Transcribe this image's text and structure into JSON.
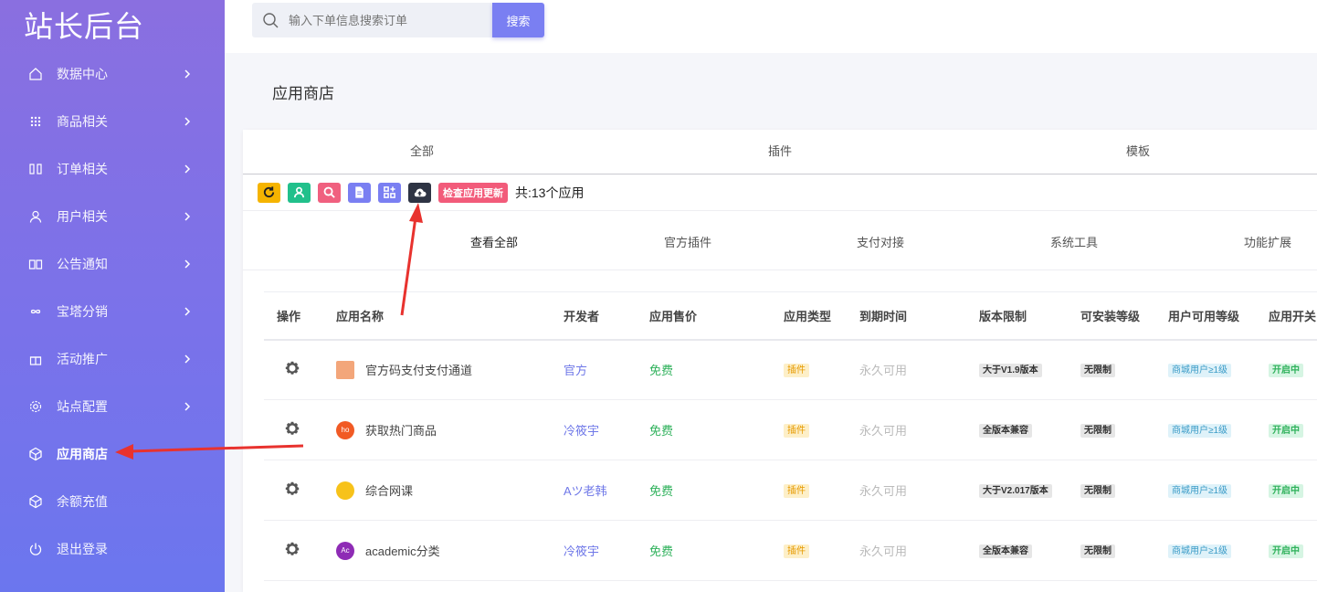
{
  "brand": "站长后台",
  "sidebar": {
    "items": [
      {
        "label": "数据中心",
        "icon": "home-icon",
        "chevron": true
      },
      {
        "label": "商品相关",
        "icon": "grid-dots-icon",
        "chevron": true
      },
      {
        "label": "订单相关",
        "icon": "columns-icon",
        "chevron": true
      },
      {
        "label": "用户相关",
        "icon": "user-icon",
        "chevron": true
      },
      {
        "label": "公告通知",
        "icon": "book-icon",
        "chevron": true
      },
      {
        "label": "宝塔分销",
        "icon": "infinity-icon",
        "chevron": true
      },
      {
        "label": "活动推广",
        "icon": "gift-icon",
        "chevron": true
      },
      {
        "label": "站点配置",
        "icon": "gear-icon",
        "chevron": true
      },
      {
        "label": "应用商店",
        "icon": "cube-icon",
        "chevron": false,
        "active": true
      },
      {
        "label": "余额充值",
        "icon": "cube-icon",
        "chevron": false
      },
      {
        "label": "退出登录",
        "icon": "power-icon",
        "chevron": false
      }
    ]
  },
  "search": {
    "placeholder": "输入下单信息搜索订单",
    "button": "搜索"
  },
  "page_title": "应用商店",
  "tabs": [
    "全部",
    "插件",
    "模板"
  ],
  "toolbar": {
    "icons": [
      {
        "name": "refresh-icon",
        "color": "#f5b400"
      },
      {
        "name": "user-icon",
        "color": "#21c08b"
      },
      {
        "name": "search-icon",
        "color": "#f0607f"
      },
      {
        "name": "document-icon",
        "color": "#7a7ff2"
      },
      {
        "name": "apps-add-icon",
        "color": "#7a7ff2"
      },
      {
        "name": "cloud-upload-icon",
        "color": "#2e3444"
      }
    ],
    "update_label": "检查应用更新",
    "count_label": "共:13个应用"
  },
  "categories": [
    "查看全部",
    "官方插件",
    "支付对接",
    "系统工具",
    "功能扩展"
  ],
  "table": {
    "headers": [
      "操作",
      "应用名称",
      "开发者",
      "应用售价",
      "应用类型",
      "到期时间",
      "版本限制",
      "可安装等级",
      "用户可用等级",
      "应用开关"
    ],
    "rows": [
      {
        "name": "官方码支付支付通道",
        "icon_color": "#f3a67a",
        "icon_text": "",
        "dev": "官方",
        "price": "免费",
        "type": "插件",
        "expire": "永久可用",
        "version": "大于V1.9版本",
        "level": "无限制",
        "user_level": "商城用户≥1级",
        "switch": "开启中"
      },
      {
        "name": "获取热门商品",
        "icon_color": "#f15a24",
        "icon_text": "ho",
        "dev": "冷筱宇",
        "price": "免费",
        "type": "插件",
        "expire": "永久可用",
        "version": "全版本兼容",
        "level": "无限制",
        "user_level": "商城用户≥1级",
        "switch": "开启中"
      },
      {
        "name": "综合网课",
        "icon_color": "#f7c21a",
        "icon_text": "",
        "dev": "Aツ老韩",
        "price": "免费",
        "type": "插件",
        "expire": "永久可用",
        "version": "大于V2.017版本",
        "level": "无限制",
        "user_level": "商城用户≥1级",
        "switch": "开启中"
      },
      {
        "name": "academic分类",
        "icon_color": "#8e2bb5",
        "icon_text": "Ac",
        "dev": "冷筱宇",
        "price": "免费",
        "type": "插件",
        "expire": "永久可用",
        "version": "全版本兼容",
        "level": "无限制",
        "user_level": "商城用户≥1级",
        "switch": "开启中"
      }
    ]
  },
  "annotation_color": "#e8322e"
}
